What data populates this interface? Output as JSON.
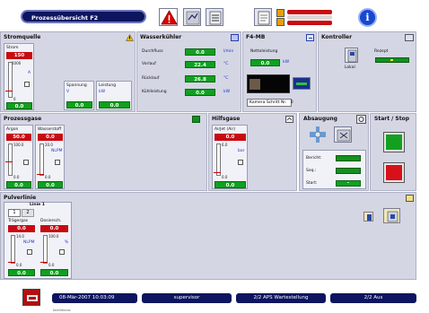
{
  "title": "Prozessübersicht F2",
  "stromquelle": {
    "header": "Stromquelle",
    "strom_label": "Strom",
    "strom_value": "150",
    "strom_max": "1000",
    "strom_min": "0",
    "strom_unit": "A",
    "strom_actual": "0.0",
    "spannung_label": "Spannung",
    "spannung_unit": "V",
    "spannung_value": "0.0",
    "leistung_label": "Leistung",
    "leistung_unit": "kW",
    "leistung_value": "0.0"
  },
  "wasserkuehler": {
    "header": "Wasserkühler",
    "rows": [
      {
        "label": "Durchfluss",
        "value": "0.0",
        "unit": "l/min"
      },
      {
        "label": "Vorlauf",
        "value": "22.4",
        "unit": "°C"
      },
      {
        "label": "Rücklauf",
        "value": "26.8",
        "unit": "°C"
      },
      {
        "label": "Kühlleistung",
        "value": "0.0",
        "unit": "kW"
      }
    ]
  },
  "f4mb": {
    "header": "F4-MB",
    "netto_label": "Nettoleistung",
    "netto_value": "0.0",
    "netto_unit": "kW",
    "kamera_label": "Kamera Schritt Nr.",
    "kamera_value": "0"
  },
  "kontroller": {
    "header": "Kontroller",
    "lokal_label": "Lokal",
    "rezept_label": "Rezept"
  },
  "prozessgase": {
    "header": "Prozessgase",
    "argon": {
      "label": "Argon",
      "set": "50.0",
      "max": "100.0",
      "min": "0.0",
      "unit": "NLPM",
      "actual": "0.0"
    },
    "wasserstoff": {
      "label": "Wasserstoff",
      "set": "0.0",
      "max": "20.0",
      "min": "0.0",
      "unit": "NLPM",
      "actual": "0.0"
    }
  },
  "hilfsgase": {
    "header": "Hilfsgase",
    "airjet": {
      "label": "AirJet (Air)",
      "set": "0.0",
      "max": "6.0",
      "min": "0.0",
      "unit": "bar",
      "actual": "0.0"
    }
  },
  "absaugung": {
    "header": "Absaugung",
    "bericht_label": "Bericht:",
    "seq_label": "Seq.:",
    "start_label": "Start:",
    "start_value": "-"
  },
  "startstop": {
    "header": "Start / Stop"
  },
  "pulverlinie": {
    "header": "Pulverlinie",
    "linie_label": "Linie 1",
    "tabs": [
      "1",
      "2"
    ],
    "traegergas": {
      "label": "Trägergas",
      "set": "0.0",
      "max": "14.0",
      "min": "0.0",
      "unit": "NLPM",
      "actual": "0.0"
    },
    "dosiersch": {
      "label": "Dosiersch.",
      "set": "0.0",
      "max": "100.0",
      "min": "0.0",
      "unit": "%",
      "actual": "0.0"
    }
  },
  "statusbar": {
    "datetime": "08-Mär-2007 10:03:09",
    "user": "supervisor",
    "aps": "2/2 APS Wartestellung",
    "aus": "2/2 Aus",
    "logo_label": "Intellitronic"
  },
  "colors": {
    "panel": "#d4d6e4",
    "green": "#10a020",
    "red": "#c80b12",
    "navy": "#0d1560"
  }
}
